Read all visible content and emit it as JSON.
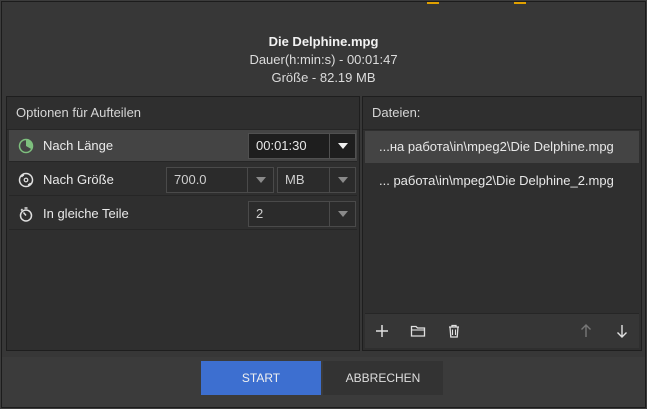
{
  "header": {
    "file_name": "Die Delphine.mpg",
    "duration": "Dauer(h:min:s) - 00:01:47",
    "size": "Größe - 82.19 MB"
  },
  "options": {
    "title": "Optionen für Aufteilen",
    "by_length": {
      "label": "Nach Länge",
      "value": "00:01:30"
    },
    "by_size": {
      "label": "Nach Größe",
      "value": "700.0",
      "unit": "MB"
    },
    "equal_parts": {
      "label": "In gleiche Teile",
      "value": "2"
    }
  },
  "files": {
    "title": "Dateien:",
    "items": [
      "...на работа\\in\\mpeg2\\Die Delphine.mpg",
      "... работа\\in\\mpeg2\\Die Delphine_2.mpg"
    ]
  },
  "footer": {
    "start_label": "START",
    "cancel_label": "ABBRECHEN"
  },
  "colors": {
    "accent": "#3d6fd0",
    "background": "#373737",
    "panel": "#2f2f2f",
    "selected_row": "#444444"
  },
  "icons": {
    "by_length": "clock-pie-icon",
    "by_size": "disc-icon",
    "equal_parts": "stopwatch-icon",
    "toolbar": [
      "plus-icon",
      "folder-icon",
      "trash-icon",
      "arrow-up-icon",
      "arrow-down-icon"
    ]
  }
}
